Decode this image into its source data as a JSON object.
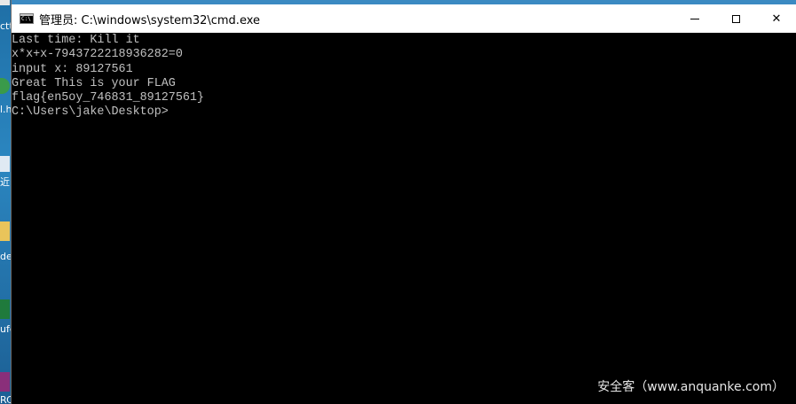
{
  "window": {
    "title": "管理员: C:\\windows\\system32\\cmd.exe",
    "minimize_icon": "minimize-icon",
    "maximize_icon": "maximize-icon",
    "close_label": "✕"
  },
  "console": {
    "lines": [
      "Last time: Kill it",
      "x*x+x-7943722218936282=0",
      "input x: 89127561",
      "Great This is your FLAG",
      "flag{en5oy_746831_89127561}",
      "C:\\Users\\jake\\Desktop>"
    ],
    "text_color": "#c0c0c0",
    "background": "#000000"
  },
  "desktop": {
    "fragments": [
      "ctt",
      "l.h",
      "近",
      "de",
      "ufe",
      "RC"
    ]
  },
  "watermark": "安全客（www.anquanke.com）"
}
